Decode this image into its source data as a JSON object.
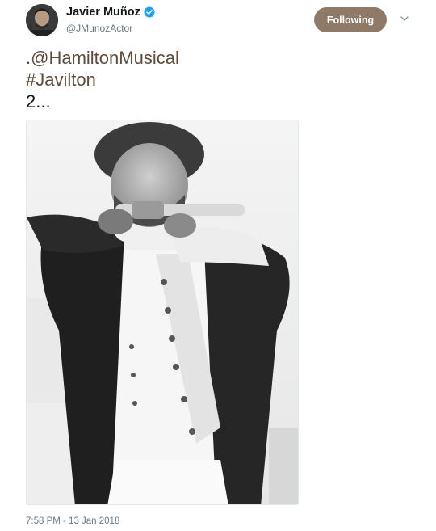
{
  "author": {
    "name": "Javier Muñoz",
    "handle": "@JMunozActor",
    "verified": true
  },
  "follow_button": {
    "label": "Following"
  },
  "menu_icon": "chevron-down-icon",
  "tweet": {
    "lines": [
      {
        "text": ".@HamiltonMusical"
      },
      {
        "text": "#Javilton"
      },
      {
        "text": "2..."
      }
    ]
  },
  "media": {
    "kind": "photo",
    "style": "black-and-white"
  },
  "timestamp": "7:58 PM - 13 Jan 2018",
  "colors": {
    "follow_bg": "#8f7a67",
    "link": "#5d4a3a",
    "secondary_text": "#657786",
    "verified": "#1da1f2"
  }
}
